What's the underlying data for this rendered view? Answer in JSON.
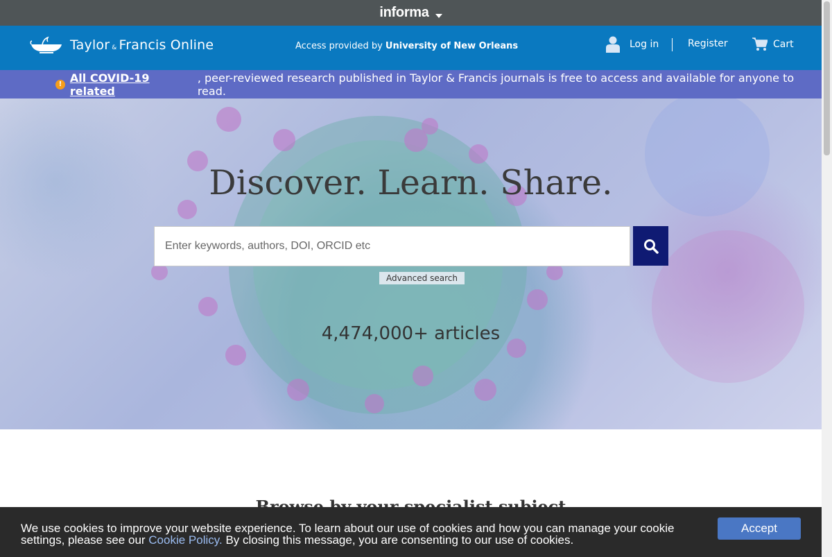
{
  "informa": {
    "logo": "informa"
  },
  "header": {
    "brand_part1": "Taylor",
    "brand_amp": "&",
    "brand_part2": "Francis Online",
    "access_prefix": "Access provided by ",
    "access_institution": "University of New Orleans",
    "login_label": "Log in",
    "register_label": "Register",
    "cart_label": "Cart"
  },
  "covid_banner": {
    "link_text": "All COVID-19 related",
    "rest_text": ", peer-reviewed research published in Taylor & Francis journals is free to access and available for anyone to read.",
    "icon": "warning-icon"
  },
  "hero": {
    "title": "Discover. Learn. Share.",
    "search_placeholder": "Enter keywords, authors, DOI, ORCID etc",
    "advanced_search": "Advanced search",
    "article_count": "4,474,000+ articles"
  },
  "browse": {
    "title": "Browse by your specialist subject"
  },
  "cookie_banner": {
    "text_before": "We use cookies to improve your website experience. To learn about our use of cookies and how you can manage your cookie settings, please see our ",
    "link": "Cookie Policy.",
    "text_after": " By closing this message, you are consenting to our use of cookies.",
    "accept": "Accept"
  },
  "colors": {
    "informa_bar": "#4f5557",
    "header_blue": "#0a79c0",
    "covid_bar": "#5e6bc5",
    "search_button": "#0f1a73",
    "accept_button": "#4a77c4",
    "warning": "#f59d1c"
  }
}
